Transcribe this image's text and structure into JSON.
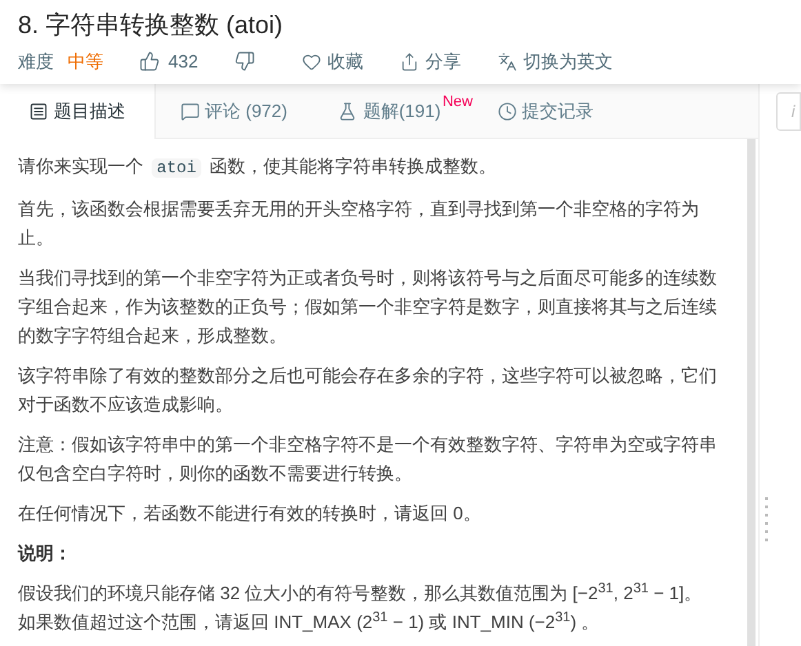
{
  "problem": {
    "title": "8. 字符串转换整数 (atoi)",
    "difficulty_label": "难度",
    "difficulty": "中等",
    "likes": "432",
    "actions": [
      {
        "kind": "favorite",
        "label": "收藏"
      },
      {
        "kind": "share",
        "label": "分享"
      },
      {
        "kind": "translate",
        "label": "切换为英文"
      }
    ]
  },
  "tabs": [
    {
      "kind": "description",
      "label": "题目描述",
      "selected": true
    },
    {
      "kind": "comments",
      "label": "评论 (972)",
      "selected": false
    },
    {
      "kind": "solutions",
      "label": "题解(191)",
      "badge": "New",
      "selected": false
    },
    {
      "kind": "submissions",
      "label": "提交记录",
      "selected": false
    }
  ],
  "side_panel": {
    "text": "i"
  },
  "content": [
    {
      "kind": "para",
      "parts": [
        {
          "kind": "text",
          "text": "请你来实现一个 "
        },
        {
          "kind": "code",
          "text": "atoi"
        },
        {
          "kind": "text",
          "text": " 函数，使其能将字符串转换成整数。"
        }
      ]
    },
    {
      "kind": "para",
      "parts": [
        {
          "kind": "text",
          "text": "首先，该函数会根据需要丢弃无用的开头空格字符，直到寻找到第一个非空格的字符为止。"
        }
      ]
    },
    {
      "kind": "para",
      "parts": [
        {
          "kind": "text",
          "text": "当我们寻找到的第一个非空字符为正或者负号时，则将该符号与之后面尽可能多的连续数字组合起来，作为该整数的正负号；假如第一个非空字符是数字，则直接将其与之后连续的数字字符组合起来，形成整数。"
        }
      ]
    },
    {
      "kind": "para",
      "parts": [
        {
          "kind": "text",
          "text": "该字符串除了有效的整数部分之后也可能会存在多余的字符，这些字符可以被忽略，它们对于函数不应该造成影响。"
        }
      ]
    },
    {
      "kind": "para",
      "parts": [
        {
          "kind": "text",
          "text": "注意：假如该字符串中的第一个非空格字符不是一个有效整数字符、字符串为空或字符串仅包含空白字符时，则你的函数不需要进行转换。"
        }
      ]
    },
    {
      "kind": "para",
      "parts": [
        {
          "kind": "text",
          "text": "在任何情况下，若函数不能进行有效的转换时，请返回 0。"
        }
      ]
    },
    {
      "kind": "heading",
      "parts": [
        {
          "kind": "text",
          "text": "说明："
        }
      ]
    },
    {
      "kind": "para",
      "parts": [
        {
          "kind": "line",
          "text": "假设我们的环境只能存储 32 位大小的有符号整数，那么其数值范围为 [−2$^{31}$,  2$^{31}$ − 1]。"
        },
        {
          "kind": "line",
          "text": "如果数值超过这个范围，请返回  INT_MAX (2$^{31}$ − 1) 或 INT_MIN (−2$^{31}$) 。"
        }
      ]
    }
  ]
}
